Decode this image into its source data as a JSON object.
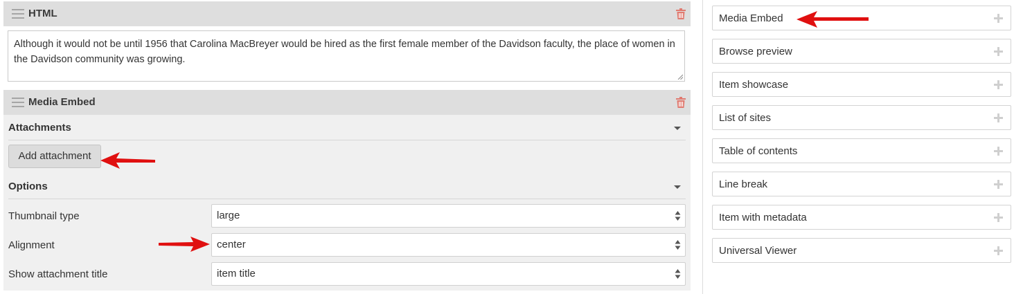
{
  "html_block": {
    "title": "HTML",
    "content": "Although it would not be until 1956 that Carolina MacBreyer would be hired as the first female member of the Davidson faculty, the place of women in the Davidson community was growing."
  },
  "media_block": {
    "title": "Media Embed",
    "attachments": {
      "heading": "Attachments",
      "add_button": "Add attachment"
    },
    "options": {
      "heading": "Options",
      "fields": [
        {
          "label": "Thumbnail type",
          "value": "large"
        },
        {
          "label": "Alignment",
          "value": "center"
        },
        {
          "label": "Show attachment title",
          "value": "item title"
        }
      ]
    }
  },
  "block_library": {
    "items": [
      {
        "label": "Media Embed"
      },
      {
        "label": "Browse preview"
      },
      {
        "label": "Item showcase"
      },
      {
        "label": "List of sites"
      },
      {
        "label": "Table of contents"
      },
      {
        "label": "Line break"
      },
      {
        "label": "Item with metadata"
      },
      {
        "label": "Universal Viewer"
      }
    ]
  },
  "colors": {
    "header_bg": "#dedede",
    "body_bg": "#f0f0f0",
    "trash_icon": "#e07a70",
    "annotation_arrow": "#e01010"
  },
  "icons": {
    "drag": "drag-handle-icon",
    "delete": "trash-icon",
    "collapse": "caret-down-icon",
    "select": "select-arrows-icon",
    "add": "plus-icon"
  }
}
